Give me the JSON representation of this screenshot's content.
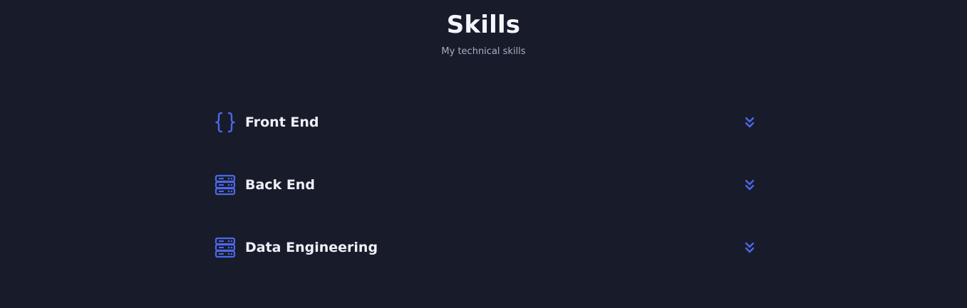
{
  "header": {
    "title": "Skills",
    "subtitle": "My technical skills"
  },
  "accent_color": "#4d68e8",
  "skills": [
    {
      "label": "Front End",
      "icon": "braces-icon"
    },
    {
      "label": "Back End",
      "icon": "server-icon"
    },
    {
      "label": "Data Engineering",
      "icon": "server-icon"
    }
  ]
}
